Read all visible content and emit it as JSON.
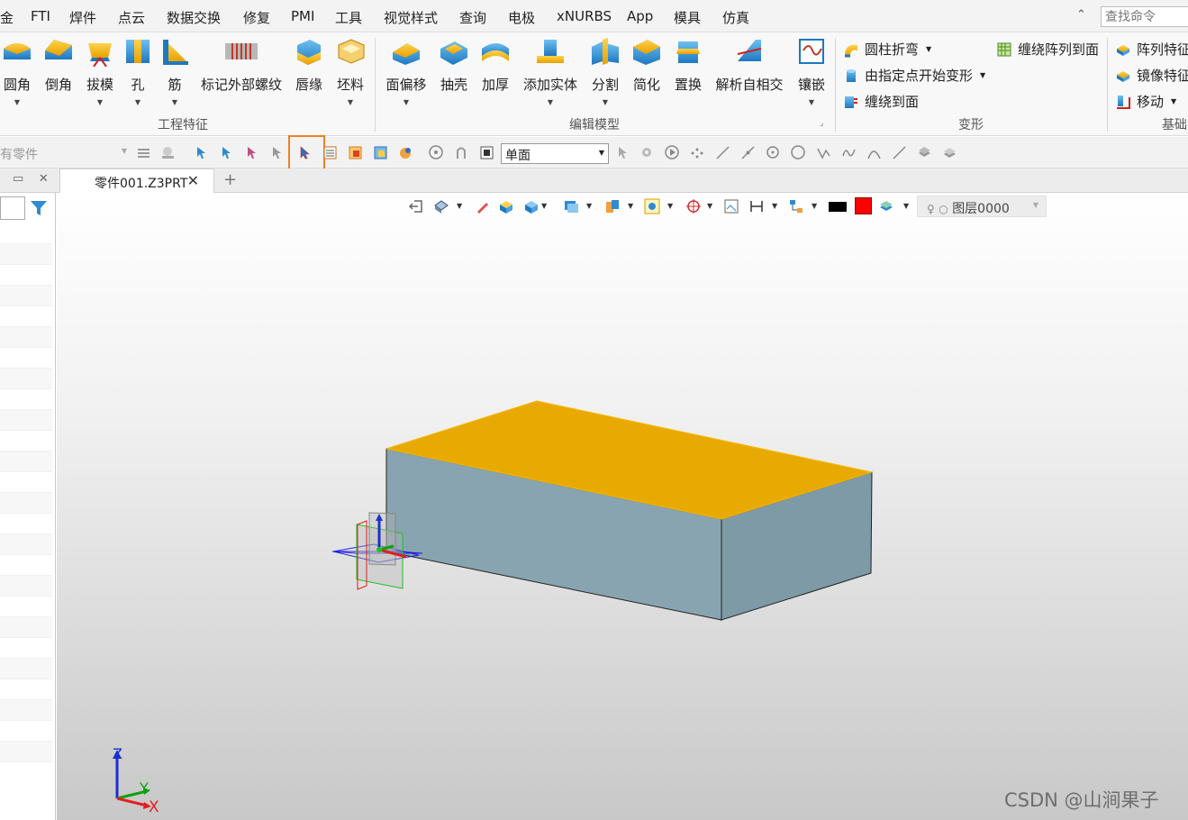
{
  "menu": {
    "items": [
      "金",
      "FTI",
      "焊件",
      "点云",
      "数据交换",
      "修复",
      "PMI",
      "工具",
      "视觉样式",
      "查询",
      "电极",
      "xNURBS",
      "App",
      "模具",
      "仿真"
    ],
    "search_placeholder": "查找命令"
  },
  "ribbon": {
    "buttons": [
      "圆角",
      "倒角",
      "拔模",
      "孔",
      "筋",
      "标记外部螺纹",
      "唇缘",
      "坯料",
      "面偏移",
      "抽壳",
      "加厚",
      "添加实体",
      "分割",
      "简化",
      "置换",
      "解析自相交",
      "镶嵌"
    ],
    "groups": {
      "engineering": "工程特征",
      "edit_model": "编辑模型",
      "deform": "变形",
      "basic": "基础"
    },
    "deform_items": [
      "圆柱折弯",
      "由指定点开始变形",
      "缠绕到面",
      "缠绕阵列到面"
    ],
    "basic_items": [
      "阵列特征",
      "镜像特征",
      "移动"
    ]
  },
  "toolbar": {
    "filter_value": "有零件",
    "face_filter": "单面"
  },
  "tabs": {
    "document": "零件001.Z3PRT",
    "add": "+",
    "close": "✕"
  },
  "view_toolbar": {
    "layer": "图层0000"
  },
  "triad": {
    "x": "X",
    "y": "Y",
    "z": "Z"
  },
  "watermark": "CSDN @山涧果子",
  "colors": {
    "top_face": "#E8AA00",
    "side_face": "#88A4B0",
    "highlight": "#F08020",
    "ribbon_blue": "#2E8BD0"
  }
}
